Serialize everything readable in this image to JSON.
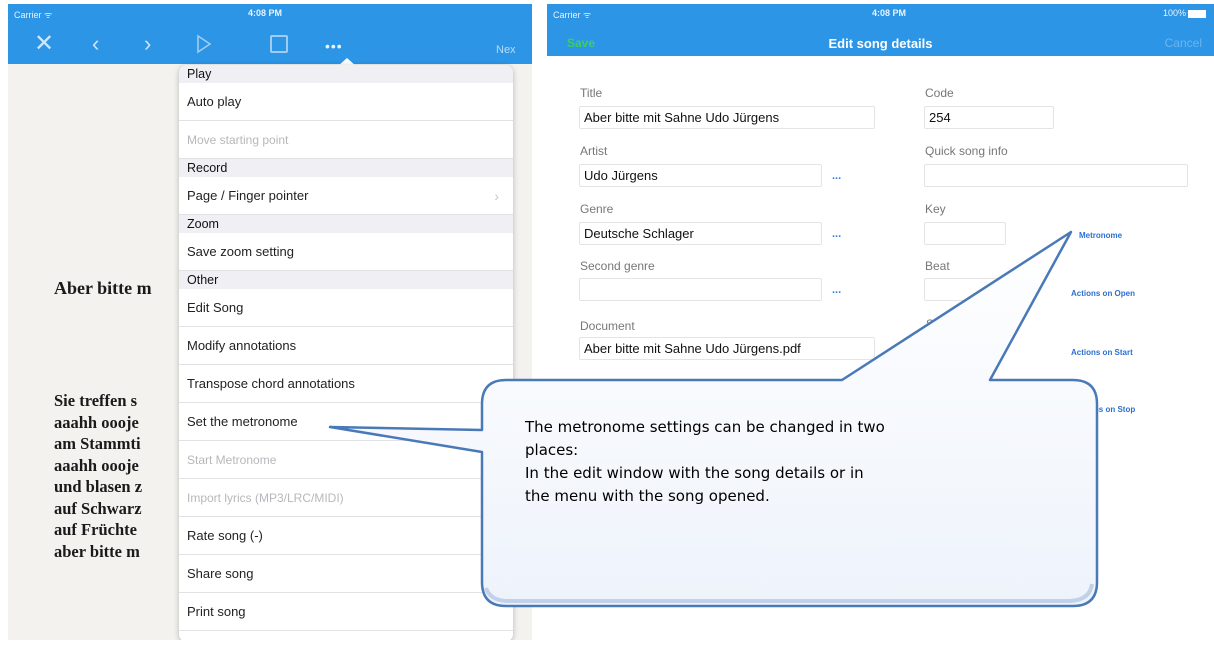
{
  "left_screen": {
    "status": {
      "carrier": "Carrier ᯤ",
      "time": "4:08 PM"
    },
    "toolbar": {
      "close": "✕",
      "back": "‹",
      "forward": "›",
      "more": "•••",
      "next": "Nex"
    },
    "song_title": "Aber bitte m",
    "lyrics": [
      "Sie treffen s",
      "aaahh oooje",
      "am Stammti",
      "aaahh oooje",
      "und blasen z",
      "auf Schwarz",
      "auf Früchte",
      "aber bitte m"
    ],
    "menu": {
      "sections": [
        {
          "header": "Play",
          "items": [
            {
              "label": "Auto play"
            },
            {
              "label": "Move starting point",
              "disabled": true
            }
          ]
        },
        {
          "header": "Record",
          "items": [
            {
              "label": "Page / Finger pointer",
              "chevron": "›"
            }
          ]
        },
        {
          "header": "Zoom",
          "items": [
            {
              "label": "Save zoom setting"
            }
          ]
        },
        {
          "header": "Other",
          "items": [
            {
              "label": "Edit Song"
            },
            {
              "label": "Modify annotations"
            },
            {
              "label": "Transpose chord annotations"
            },
            {
              "label": "Set the metronome"
            },
            {
              "label": "Start Metronome",
              "disabled": true
            },
            {
              "label": "Import lyrics (MP3/LRC/MIDI)",
              "disabled": true
            },
            {
              "label": "Rate song (-)"
            },
            {
              "label": "Share song"
            },
            {
              "label": "Print song"
            }
          ]
        }
      ]
    }
  },
  "right_screen": {
    "status": {
      "carrier": "Carrier ᯤ",
      "time": "4:08 PM",
      "battery": "100%"
    },
    "nav": {
      "save": "Save",
      "title": "Edit song details",
      "cancel": "Cancel"
    },
    "form": {
      "title_label": "Title",
      "title_value": "Aber bitte mit Sahne Udo Jürgens",
      "code_label": "Code",
      "code_value": "254",
      "artist_label": "Artist",
      "artist_value": "Udo Jürgens",
      "quick_info_label": "Quick song info",
      "quick_info_value": "",
      "genre_label": "Genre",
      "genre_value": "Deutsche Schlager",
      "key_label": "Key",
      "key_value": "",
      "second_genre_label": "Second genre",
      "second_genre_value": "",
      "beat_label": "Beat",
      "beat_value": "",
      "document_label": "Document",
      "document_value": "Aber bitte mit Sahne Udo Jürgens.pdf",
      "partial_label": "S",
      "more_dots": "..."
    },
    "links": {
      "metronome": "Metronome",
      "actions_open": "Actions on Open",
      "actions_start": "Actions on Start",
      "actions_stop": "ons on Stop"
    }
  },
  "callout": {
    "lines": [
      "The metronome settings can be changed in two",
      "places:",
      "In the edit window with the song details or in",
      "the menu with the song opened."
    ]
  },
  "colors": {
    "nav_blue": "#2d95e6",
    "save_green": "#3ccf5b",
    "link_blue": "#2d6fd0",
    "callout_stroke": "#4a79b8"
  }
}
